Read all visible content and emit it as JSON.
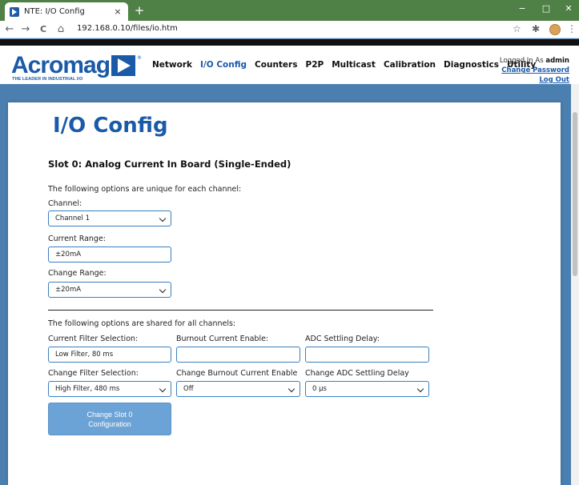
{
  "browser": {
    "tab_title": "NTE: I/O Config",
    "tab_close": "×",
    "new_tab": "+",
    "url": "192.168.0.10/files/io.htm",
    "back": "←",
    "forward": "→",
    "reload": "C",
    "home": "⌂",
    "star": "☆",
    "extensions": "✱",
    "menu": "⋮",
    "minimize": "−",
    "maximize": "□",
    "close": "✕"
  },
  "header": {
    "logo_text": "Acromag",
    "logo_tagline": "THE LEADER IN INDUSTRIAL I/O",
    "logo_reg": "®",
    "nav": [
      {
        "label": "Network",
        "active": false
      },
      {
        "label": "I/O Config",
        "active": true
      },
      {
        "label": "Counters",
        "active": false
      },
      {
        "label": "P2P",
        "active": false
      },
      {
        "label": "Multicast",
        "active": false
      },
      {
        "label": "Calibration",
        "active": false
      },
      {
        "label": "Diagnostics",
        "active": false
      },
      {
        "label": "Utility",
        "active": false
      }
    ],
    "logged_in_prefix": "Logged In As",
    "username": "admin",
    "change_password": "Change Password",
    "log_out": "Log Out"
  },
  "main": {
    "title": "I/O Config",
    "slot_title": "Slot 0: Analog Current In Board (Single-Ended)",
    "unique_note": "The following options are unique for each channel:",
    "channel_label": "Channel:",
    "channel_value": "Channel 1",
    "current_range_label": "Current Range:",
    "current_range_value": "±20mA",
    "change_range_label": "Change Range:",
    "change_range_value": "±20mA",
    "shared_note": "The following options are shared for all channels:",
    "current_filter_label": "Current Filter Selection:",
    "current_filter_value": "Low Filter, 80 ms",
    "burnout_label": "Burnout Current Enable:",
    "burnout_value": "",
    "adc_delay_label": "ADC Settling Delay:",
    "adc_delay_value": "",
    "change_filter_label": "Change Filter Selection:",
    "change_filter_value": "High Filter, 480 ms",
    "change_burnout_label": "Change Burnout Current Enable",
    "change_burnout_value": "Off",
    "change_adc_label": "Change ADC Settling Delay",
    "change_adc_value": "0 µs",
    "submit_button": "Change Slot 0 Configuration"
  },
  "colors": {
    "accent": "#1b5aa8",
    "background": "#4a7fb0",
    "tabbar": "#4f8045",
    "button": "#6ca3d6"
  }
}
